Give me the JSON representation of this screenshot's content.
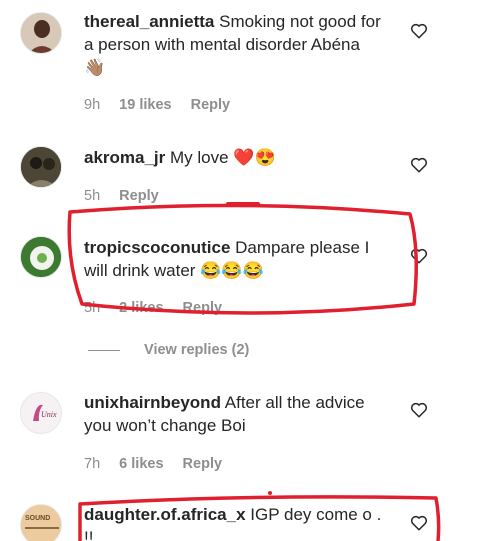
{
  "comments": [
    {
      "username": "thereal_annietta",
      "text": "Smoking not good for a person with mental disorder Abéna",
      "emoji": "👋🏽",
      "time": "9h",
      "likes": "19 likes",
      "reply": "Reply"
    },
    {
      "username": "akroma_jr",
      "text": "My love",
      "emoji": "❤️😍",
      "time": "5h",
      "likes": "",
      "reply": "Reply"
    },
    {
      "username": "tropicscoconutice",
      "text": "Dampare please I will drink water",
      "emoji": "😂😂😂",
      "time": "5h",
      "likes": "2 likes",
      "reply": "Reply"
    },
    {
      "username": "unixhairnbeyond",
      "text": "After all the advice you won’t change Boi",
      "emoji": "",
      "time": "7h",
      "likes": "6 likes",
      "reply": "Reply"
    },
    {
      "username": "daughter.of.africa_x",
      "text": "IGP dey come o . !!",
      "emoji": "",
      "time": "",
      "likes": "",
      "reply": ""
    }
  ],
  "view_replies": "View replies (2)",
  "avatars": {
    "unix_label": "Unix",
    "sound_label": "SOUND"
  },
  "colors": {
    "annotation": "#e0202e",
    "meta": "#8e8e8e"
  }
}
